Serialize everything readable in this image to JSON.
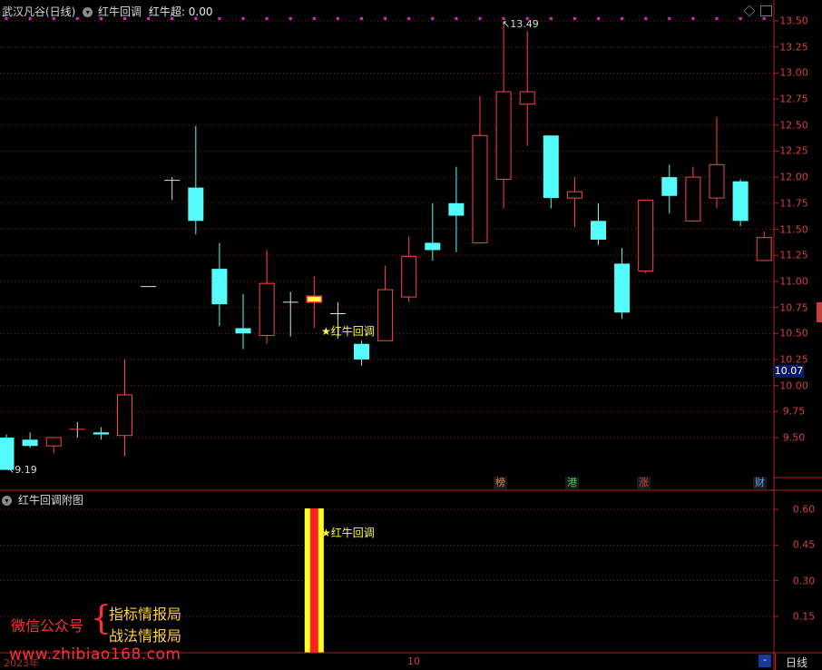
{
  "header": {
    "instrument": "武汉凡谷(日线)",
    "indicator_name": "红牛回调",
    "indicator_label": "红牛超:",
    "indicator_value": "0.00"
  },
  "main_axis": {
    "ticks": [
      "13.50",
      "13.25",
      "13.00",
      "12.75",
      "12.50",
      "12.25",
      "12.00",
      "11.75",
      "11.50",
      "11.25",
      "11.00",
      "10.75",
      "10.50",
      "10.25",
      "10.00",
      "9.75",
      "9.50"
    ],
    "current_price": "10.07"
  },
  "annotations": {
    "high": "13.49",
    "low": "9.19",
    "signal": "★红牛回调"
  },
  "badges": [
    "榜",
    "港",
    "涨",
    "财"
  ],
  "sub_panel": {
    "title": "红牛回调附图",
    "ticks": [
      "0.60",
      "0.45",
      "0.30",
      "0.15"
    ],
    "signal": "★红牛回调"
  },
  "footer": {
    "year": "2023年",
    "month": "10",
    "period": "日线"
  },
  "watermark": {
    "wechat": "微信公众号",
    "line1": "指标情报局",
    "line2": "战法情报局",
    "url": "www.zhibiao168.com"
  },
  "colors": {
    "up": "#ff4444",
    "down": "#54fcfc",
    "grid": "#8b1a1a",
    "signal": "#ffff44"
  },
  "chart_data": [
    {
      "type": "candlestick",
      "ylim": [
        9.0,
        13.6
      ],
      "candles": [
        {
          "o": 9.5,
          "h": 9.53,
          "l": 9.2,
          "c": 9.19
        },
        {
          "o": 9.48,
          "h": 9.55,
          "l": 9.4,
          "c": 9.42
        },
        {
          "o": 9.42,
          "h": 9.5,
          "l": 9.35,
          "c": 9.5
        },
        {
          "o": 9.57,
          "h": 9.65,
          "l": 9.5,
          "c": 9.58
        },
        {
          "o": 9.55,
          "h": 9.6,
          "l": 9.48,
          "c": 9.53
        },
        {
          "o": 9.52,
          "h": 10.25,
          "l": 9.32,
          "c": 9.91
        },
        {
          "o": 10.95,
          "h": 10.95,
          "l": 10.95,
          "c": 10.95
        },
        {
          "o": 11.97,
          "h": 12.0,
          "l": 11.78,
          "c": 11.97
        },
        {
          "o": 11.9,
          "h": 12.49,
          "l": 11.45,
          "c": 11.58
        },
        {
          "o": 11.12,
          "h": 11.37,
          "l": 10.57,
          "c": 10.78
        },
        {
          "o": 10.55,
          "h": 10.88,
          "l": 10.35,
          "c": 10.5
        },
        {
          "o": 10.48,
          "h": 11.3,
          "l": 10.4,
          "c": 10.98
        },
        {
          "o": 10.8,
          "h": 10.9,
          "l": 10.47,
          "c": 10.8
        },
        {
          "o": 10.8,
          "h": 11.05,
          "l": 10.55,
          "c": 10.84
        },
        {
          "o": 10.68,
          "h": 10.8,
          "l": 10.45,
          "c": 10.69
        },
        {
          "o": 10.4,
          "h": 10.43,
          "l": 10.19,
          "c": 10.25
        },
        {
          "o": 10.43,
          "h": 11.15,
          "l": 10.43,
          "c": 10.92
        },
        {
          "o": 10.85,
          "h": 11.43,
          "l": 10.8,
          "c": 11.24
        },
        {
          "o": 11.37,
          "h": 11.75,
          "l": 11.2,
          "c": 11.3
        },
        {
          "o": 11.75,
          "h": 12.1,
          "l": 11.28,
          "c": 11.63
        },
        {
          "o": 11.37,
          "h": 12.78,
          "l": 11.37,
          "c": 12.4
        },
        {
          "o": 11.98,
          "h": 13.49,
          "l": 11.7,
          "c": 12.82
        },
        {
          "o": 12.7,
          "h": 13.4,
          "l": 12.3,
          "c": 12.82
        },
        {
          "o": 12.4,
          "h": 12.4,
          "l": 11.7,
          "c": 11.8
        },
        {
          "o": 11.8,
          "h": 12.0,
          "l": 11.52,
          "c": 11.86
        },
        {
          "o": 11.58,
          "h": 11.75,
          "l": 11.35,
          "c": 11.4
        },
        {
          "o": 11.17,
          "h": 11.32,
          "l": 10.64,
          "c": 10.7
        },
        {
          "o": 11.1,
          "h": 11.78,
          "l": 11.08,
          "c": 11.78
        },
        {
          "o": 12.0,
          "h": 12.12,
          "l": 11.65,
          "c": 11.82
        },
        {
          "o": 11.58,
          "h": 12.1,
          "l": 11.57,
          "c": 12.0
        },
        {
          "o": 11.8,
          "h": 12.58,
          "l": 11.7,
          "c": 12.12
        },
        {
          "o": 11.96,
          "h": 11.98,
          "l": 11.53,
          "c": 11.58
        },
        {
          "o": 11.2,
          "h": 11.48,
          "l": 11.2,
          "c": 11.42
        }
      ],
      "signal_index": 13
    },
    {
      "type": "bar",
      "ylim": [
        0,
        0.65
      ],
      "bars": [
        {
          "index": 13,
          "value": 1.0
        }
      ]
    }
  ]
}
